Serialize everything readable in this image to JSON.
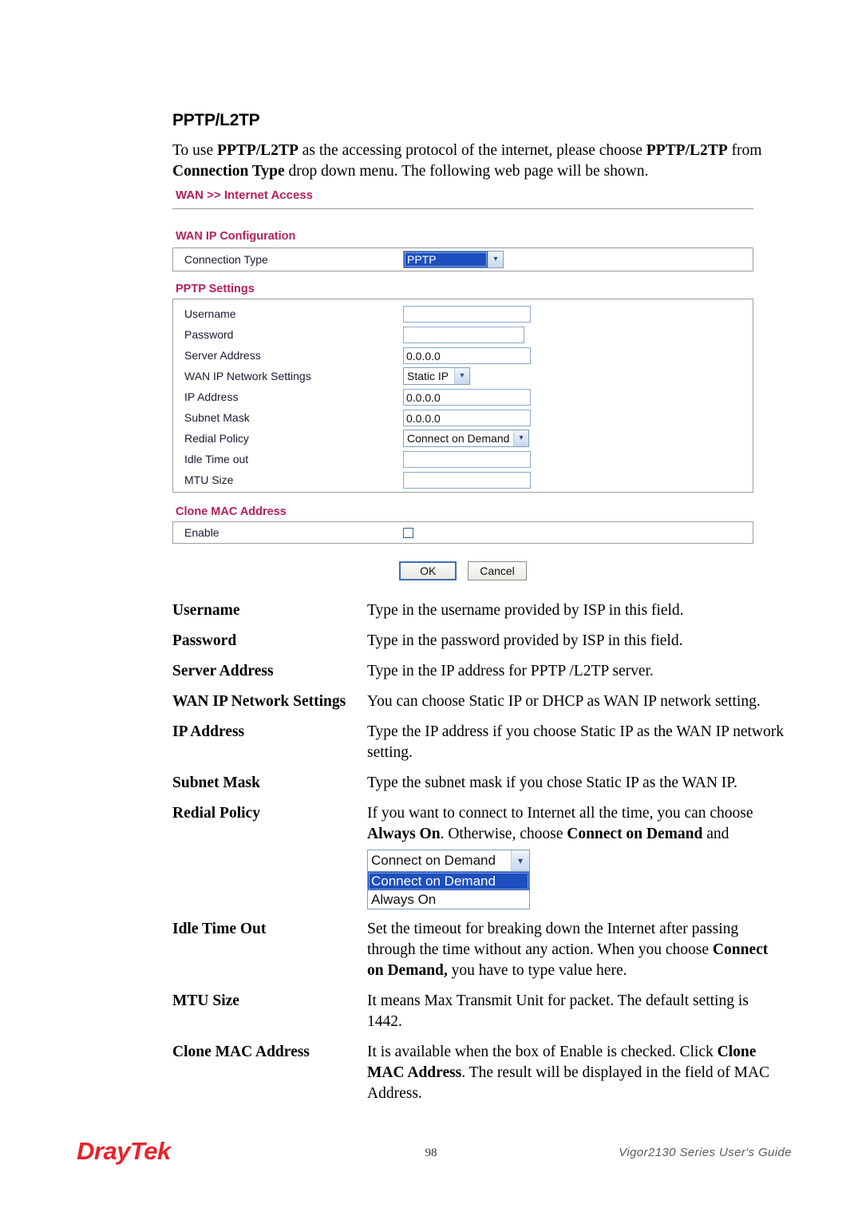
{
  "page": {
    "heading": "PPTP/L2TP",
    "intro_segments": [
      {
        "text": "To use ",
        "bold": false
      },
      {
        "text": "PPTP/L2TP",
        "bold": true
      },
      {
        "text": " as the accessing protocol of the internet, please choose ",
        "bold": false
      },
      {
        "text": "PPTP/L2TP",
        "bold": true
      },
      {
        "text": " from ",
        "bold": false
      },
      {
        "text": "Connection Type",
        "bold": true
      },
      {
        "text": " drop down menu. The following web page will be shown.",
        "bold": false
      }
    ]
  },
  "router_ui": {
    "breadcrumb": "WAN >> Internet Access",
    "wan_ip_configuration": {
      "title": "WAN IP Configuration",
      "connection_type": {
        "label": "Connection Type",
        "value": "PPTP",
        "arrow_icon": "chevron-down-icon"
      }
    },
    "pptp_settings": {
      "title": "PPTP Settings",
      "fields": [
        {
          "label": "Username",
          "type": "text",
          "value": ""
        },
        {
          "label": "Password",
          "type": "text",
          "value": ""
        },
        {
          "label": "Server Address",
          "type": "text",
          "value": "0.0.0.0"
        },
        {
          "label": "WAN IP Network Settings",
          "type": "select",
          "value": "Static IP"
        },
        {
          "label": "IP Address",
          "type": "text",
          "value": "0.0.0.0"
        },
        {
          "label": "Subnet Mask",
          "type": "text",
          "value": "0.0.0.0"
        },
        {
          "label": "Redial Policy",
          "type": "select",
          "value": "Connect on Demand"
        },
        {
          "label": "Idle Time out",
          "type": "text",
          "value": ""
        },
        {
          "label": "MTU Size",
          "type": "text",
          "value": ""
        }
      ]
    },
    "clone_mac_address": {
      "title": "Clone MAC Address",
      "enable_label": "Enable",
      "enabled": false
    },
    "buttons": {
      "ok": "OK",
      "cancel": "Cancel"
    }
  },
  "descriptions": [
    {
      "term": "Username",
      "lines": [
        [
          {
            "text": "Type in the username provided by ISP in this field.",
            "bold": false
          }
        ]
      ]
    },
    {
      "term": "Password",
      "lines": [
        [
          {
            "text": "Type in the password provided by ISP in this field.",
            "bold": false
          }
        ]
      ]
    },
    {
      "term": "Server Address",
      "lines": [
        [
          {
            "text": "Type in the IP address for PPTP /L2TP server.",
            "bold": false
          }
        ]
      ]
    },
    {
      "term": "WAN IP Network Settings",
      "lines": [
        [
          {
            "text": "You can choose Static IP or DHCP as WAN IP network setting.",
            "bold": false
          }
        ]
      ]
    },
    {
      "term": "IP Address",
      "lines": [
        [
          {
            "text": "Type the IP address if you choose Static IP as the WAN IP network setting.",
            "bold": false
          }
        ]
      ]
    },
    {
      "term": "Subnet Mask",
      "lines": [
        [
          {
            "text": "Type the subnet mask if you chose Static IP as the WAN IP.",
            "bold": false
          }
        ]
      ]
    },
    {
      "term": "Redial Policy",
      "lines": [
        [
          {
            "text": "If you want to connect to Internet all the time, you can choose ",
            "bold": false
          },
          {
            "text": "Always On",
            "bold": true
          },
          {
            "text": ". Otherwise, choose ",
            "bold": false
          },
          {
            "text": "Connect on Demand",
            "bold": true
          },
          {
            "text": " and",
            "bold": false
          }
        ]
      ],
      "figure": {
        "selected": "Connect on Demand",
        "options": [
          "Connect on Demand",
          "Always On"
        ],
        "arrow_icon": "chevron-down-icon"
      }
    },
    {
      "term": "Idle Time Out",
      "lines": [
        [
          {
            "text": "Set the timeout for breaking down the Internet after passing through the time without any action. When you choose ",
            "bold": false
          },
          {
            "text": "Connect on Demand,",
            "bold": true
          },
          {
            "text": " you have to type value here.",
            "bold": false
          }
        ]
      ]
    },
    {
      "term": "MTU Size",
      "lines": [
        [
          {
            "text": "It means Max Transmit Unit for packet. The default setting is 1442.",
            "bold": false
          }
        ]
      ]
    },
    {
      "term": "Clone MAC Address",
      "lines": [
        [
          {
            "text": "It is available when the box of Enable is checked. Click ",
            "bold": false
          },
          {
            "text": "Clone MAC Address",
            "bold": true
          },
          {
            "text": ". The result will be displayed in the field of MAC Address.",
            "bold": false
          }
        ]
      ]
    }
  ],
  "footer": {
    "logo_dray": "Dray",
    "logo_tek": "Tek",
    "page_number": "98",
    "guide": "Vigor2130 Series User's Guide"
  },
  "colors": {
    "heading_crimson": "#b4215c",
    "select_highlight": "#1d4fbe",
    "logo_red": "#e8232a"
  }
}
